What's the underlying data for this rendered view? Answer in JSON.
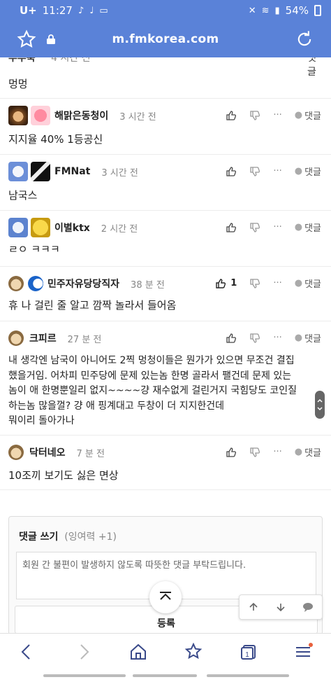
{
  "status": {
    "time": "11:27",
    "carrier": "U+",
    "battery": "54%"
  },
  "browser": {
    "url": "m.fmkorea.com"
  },
  "partial_comment": {
    "author_fragment": "루루북",
    "time_fragment": "4 시간 전",
    "reply_fragment": "댓글",
    "text": "멍멍"
  },
  "comments": [
    {
      "author": "해맑은동청이",
      "time": "3 시간 전",
      "text": "지지율 40% 1등공신",
      "reply": "댓글"
    },
    {
      "author": "FMNat",
      "time": "3 시간 전",
      "text": "남국스",
      "reply": "댓글"
    },
    {
      "author": "이별ktx",
      "time": "2 시간 전",
      "text": "ㄹㅇ ㅋㅋㅋ",
      "reply": "댓글"
    },
    {
      "author": "민주자유당당직자",
      "time": "38 분 전",
      "text": "휴 나 걸린 줄 알고 깜짝 놀라서 들어옴",
      "likes": "1",
      "reply": "댓글"
    },
    {
      "author": "크피르",
      "time": "27 분 전",
      "lines": [
        "내 생각엔 남국이 아니어도 2찍 멍청이들은 뭔가가 있으면 무조건 결집",
        "했을거임. 어차피 민주당에 문제 있는놈 한명 골라서 팰건데 문제 있는",
        "놈이 애 한명뿐일리 없지~~~~걍 재수없게 걸린거지 국힘당도 코인질",
        "하는놈 많을껄? 걍 애 핑계대고 두창이 더 지지한건데",
        "뭐이리 돌아가나"
      ],
      "reply": "댓글"
    },
    {
      "author": "닥터네오",
      "time": "7 분 전",
      "text": "10조끼 보기도 싫은 면상",
      "reply": "댓글"
    }
  ],
  "write": {
    "title": "댓글 쓰기",
    "points": "(잉여력 +1)",
    "placeholder": "회원 간 불편이 발생하지 않도록 따뜻한 댓글 부탁드립니다.",
    "submit": "등록"
  },
  "colors": {
    "header": "#5a82d8",
    "accent": "#e8603c"
  }
}
